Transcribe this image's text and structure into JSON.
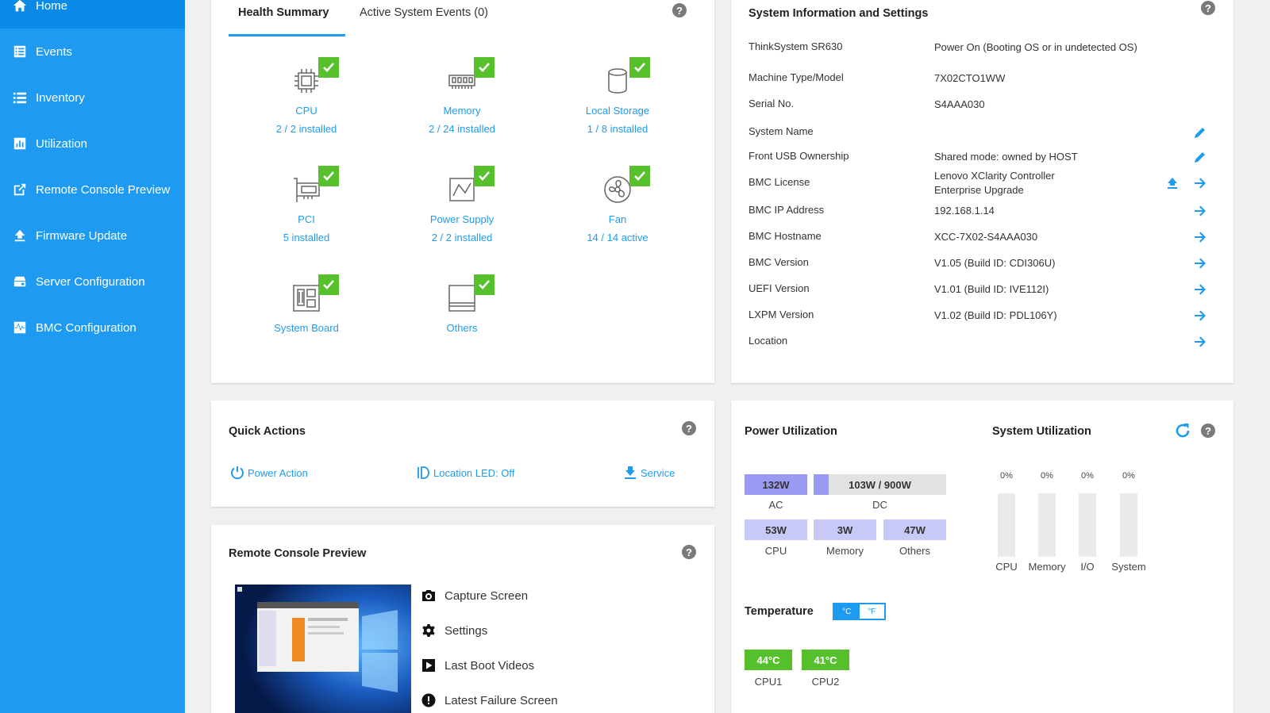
{
  "sidebar": {
    "items": [
      {
        "label": "Home",
        "icon": "home-icon"
      },
      {
        "label": "Events",
        "icon": "events-icon"
      },
      {
        "label": "Inventory",
        "icon": "list-icon"
      },
      {
        "label": "Utilization",
        "icon": "chart-icon"
      },
      {
        "label": "Remote Console Preview",
        "icon": "external-link-icon"
      },
      {
        "label": "Firmware Update",
        "icon": "upload-icon"
      },
      {
        "label": "Server Configuration",
        "icon": "server-icon"
      },
      {
        "label": "BMC Configuration",
        "icon": "pulse-icon"
      }
    ]
  },
  "health": {
    "tabs": [
      "Health Summary",
      "Active System Events (0)"
    ],
    "components": [
      {
        "name": "CPU",
        "count": "2 / 2 installed",
        "icon": "cpu-icon"
      },
      {
        "name": "Memory",
        "count": "2 / 24 installed",
        "icon": "memory-icon"
      },
      {
        "name": "Local Storage",
        "count": "1 / 8 installed",
        "icon": "storage-icon"
      },
      {
        "name": "PCI",
        "count": "5 installed",
        "icon": "pci-icon"
      },
      {
        "name": "Power Supply",
        "count": "2 / 2 installed",
        "icon": "power-supply-icon"
      },
      {
        "name": "Fan",
        "count": "14 / 14 active",
        "icon": "fan-icon"
      },
      {
        "name": "System Board",
        "count": "",
        "icon": "system-board-icon"
      },
      {
        "name": "Others",
        "count": "",
        "icon": "others-icon"
      }
    ]
  },
  "sysinfo": {
    "title": "System Information and Settings",
    "rows": [
      {
        "label": "ThinkSystem SR630",
        "value": "Power On (Booting OS or in undetected OS)"
      },
      {
        "label": "Machine Type/Model",
        "value": "7X02CTO1WW"
      },
      {
        "label": "Serial No.",
        "value": "S4AAA030"
      },
      {
        "label": "System Name",
        "value": ""
      },
      {
        "label": "Front USB Ownership",
        "value": "Shared mode: owned by HOST"
      },
      {
        "label": "BMC License",
        "value": "Lenovo XClarity Controller\nEnterprise Upgrade"
      },
      {
        "label": "BMC IP Address",
        "value": "192.168.1.14"
      },
      {
        "label": "BMC Hostname",
        "value": "XCC-7X02-S4AAA030"
      },
      {
        "label": "BMC Version",
        "value": "V1.05 (Build ID: CDI306U)"
      },
      {
        "label": "UEFI Version",
        "value": "V1.01 (Build ID: IVE112I)"
      },
      {
        "label": "LXPM Version",
        "value": "V1.02 (Build ID: PDL106Y)"
      },
      {
        "label": "Location",
        "value": ""
      }
    ]
  },
  "quick": {
    "title": "Quick Actions",
    "power": "Power Action",
    "led": "Location LED: Off",
    "service": "Service"
  },
  "remote": {
    "title": "Remote Console Preview",
    "items": [
      "Capture Screen",
      "Settings",
      "Last Boot Videos",
      "Latest Failure Screen"
    ]
  },
  "power": {
    "title": "Power Utilization",
    "ac": "132W",
    "ac_label": "AC",
    "dc": "103W / 900W",
    "dc_fraction": 0.114,
    "dc_label": "DC",
    "cpu": "53W",
    "cpu_label": "CPU",
    "memory": "3W",
    "memory_label": "Memory",
    "others": "47W",
    "others_label": "Others"
  },
  "utilization": {
    "title": "System Utilization",
    "items": [
      {
        "label": "CPU",
        "pct": "0%"
      },
      {
        "label": "Memory",
        "pct": "0%"
      },
      {
        "label": "I/O",
        "pct": "0%"
      },
      {
        "label": "System",
        "pct": "0%"
      }
    ]
  },
  "temperature": {
    "title": "Temperature",
    "unit_c": "°C",
    "unit_f": "°F",
    "sensors": [
      {
        "label": "CPU1",
        "value": "44°C"
      },
      {
        "label": "CPU2",
        "value": "41°C"
      }
    ]
  },
  "colors": {
    "accent": "#1e9bf0",
    "ok": "#56c02d",
    "power_bar": "#9a9af2"
  }
}
